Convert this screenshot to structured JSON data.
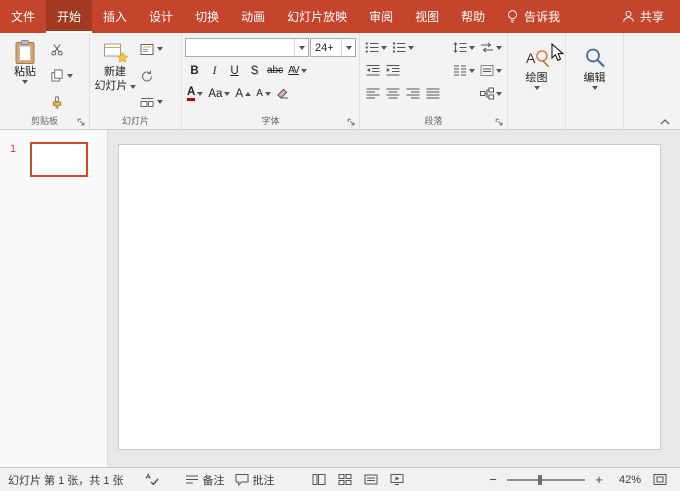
{
  "titlebar": {
    "tabs": [
      {
        "label": "文件"
      },
      {
        "label": "开始",
        "active": true
      },
      {
        "label": "插入"
      },
      {
        "label": "设计"
      },
      {
        "label": "切换"
      },
      {
        "label": "动画"
      },
      {
        "label": "幻灯片放映"
      },
      {
        "label": "审阅"
      },
      {
        "label": "视图"
      },
      {
        "label": "帮助"
      }
    ],
    "tellme_label": "告诉我",
    "share_label": "共享"
  },
  "ribbon": {
    "paste_label": "粘贴",
    "new_slide_line1": "新建",
    "new_slide_line2": "幻灯片",
    "groups": {
      "clipboard": "剪贴板",
      "slides": "幻灯片",
      "font": "字体",
      "paragraph": "段落"
    },
    "font_name_value": "",
    "font_size_value": "24+",
    "bold_label": "B",
    "italic_label": "I",
    "underline_label": "U",
    "shadow_label": "S",
    "strikethrough_label": "abc",
    "spacing_label": "AV",
    "font_color_label": "A",
    "change_case_label": "Aa",
    "grow_font_label": "A",
    "shrink_font_label": "A",
    "draw_label": "绘图",
    "edit_label": "编辑"
  },
  "slides_panel": {
    "slide_number": "1"
  },
  "statusbar": {
    "slide_info": "幻灯片 第 1 张，共 1 张",
    "notes_label": "备注",
    "comments_label": "批注",
    "zoom_out": "−",
    "zoom_in": "+",
    "zoom_value": "42%"
  },
  "colors": {
    "accent": "#c4452b",
    "active_tab": "#a13a20",
    "selected_thumbnail_border": "#ce4a2c"
  }
}
